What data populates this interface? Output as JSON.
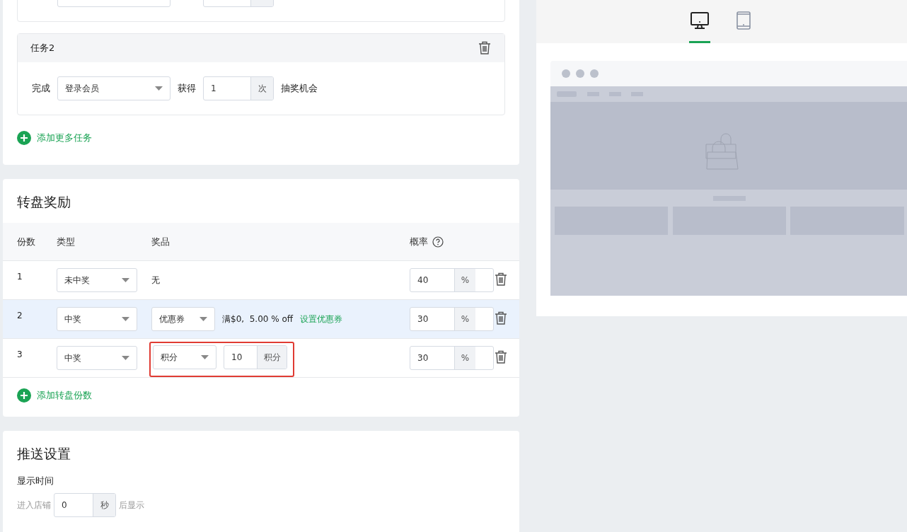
{
  "tasks": [
    {
      "kind": "cut"
    },
    {
      "kind": "full",
      "title": "任务2",
      "complete_label": "完成",
      "action": "登录会员",
      "gain_label": "获得",
      "times": "1",
      "unit": "次",
      "suffix": "抽奖机会"
    }
  ],
  "add_task": "添加更多任务",
  "wheel": {
    "title": "转盘奖励",
    "columns": [
      "份数",
      "类型",
      "奖品",
      "概率"
    ],
    "rows": [
      {
        "index": "1",
        "type": "未中奖",
        "prize": {
          "kind": "none",
          "text": "无"
        },
        "probability": "40",
        "unit": "%",
        "highlighted": false
      },
      {
        "index": "2",
        "type": "中奖",
        "prize": {
          "kind": "coupon",
          "select": "优惠券",
          "detail": "满$0,  5.00 % off",
          "link": "设置优惠券"
        },
        "probability": "30",
        "unit": "%",
        "highlighted": true
      },
      {
        "index": "3",
        "type": "中奖",
        "prize": {
          "kind": "points",
          "select": "积分",
          "value": "10",
          "unit": "积分",
          "outlined": true
        },
        "probability": "30",
        "unit": "%",
        "highlighted": false
      }
    ],
    "add": "添加转盘份数"
  },
  "push": {
    "title": "推送设置",
    "field_label": "显示时间",
    "prefix": "进入店铺",
    "value": "0",
    "unit": "秒",
    "suffix": "后显示"
  },
  "preview": {
    "devices": [
      {
        "kind": "desktop",
        "selected": true
      },
      {
        "kind": "tablet",
        "selected": false
      }
    ]
  }
}
